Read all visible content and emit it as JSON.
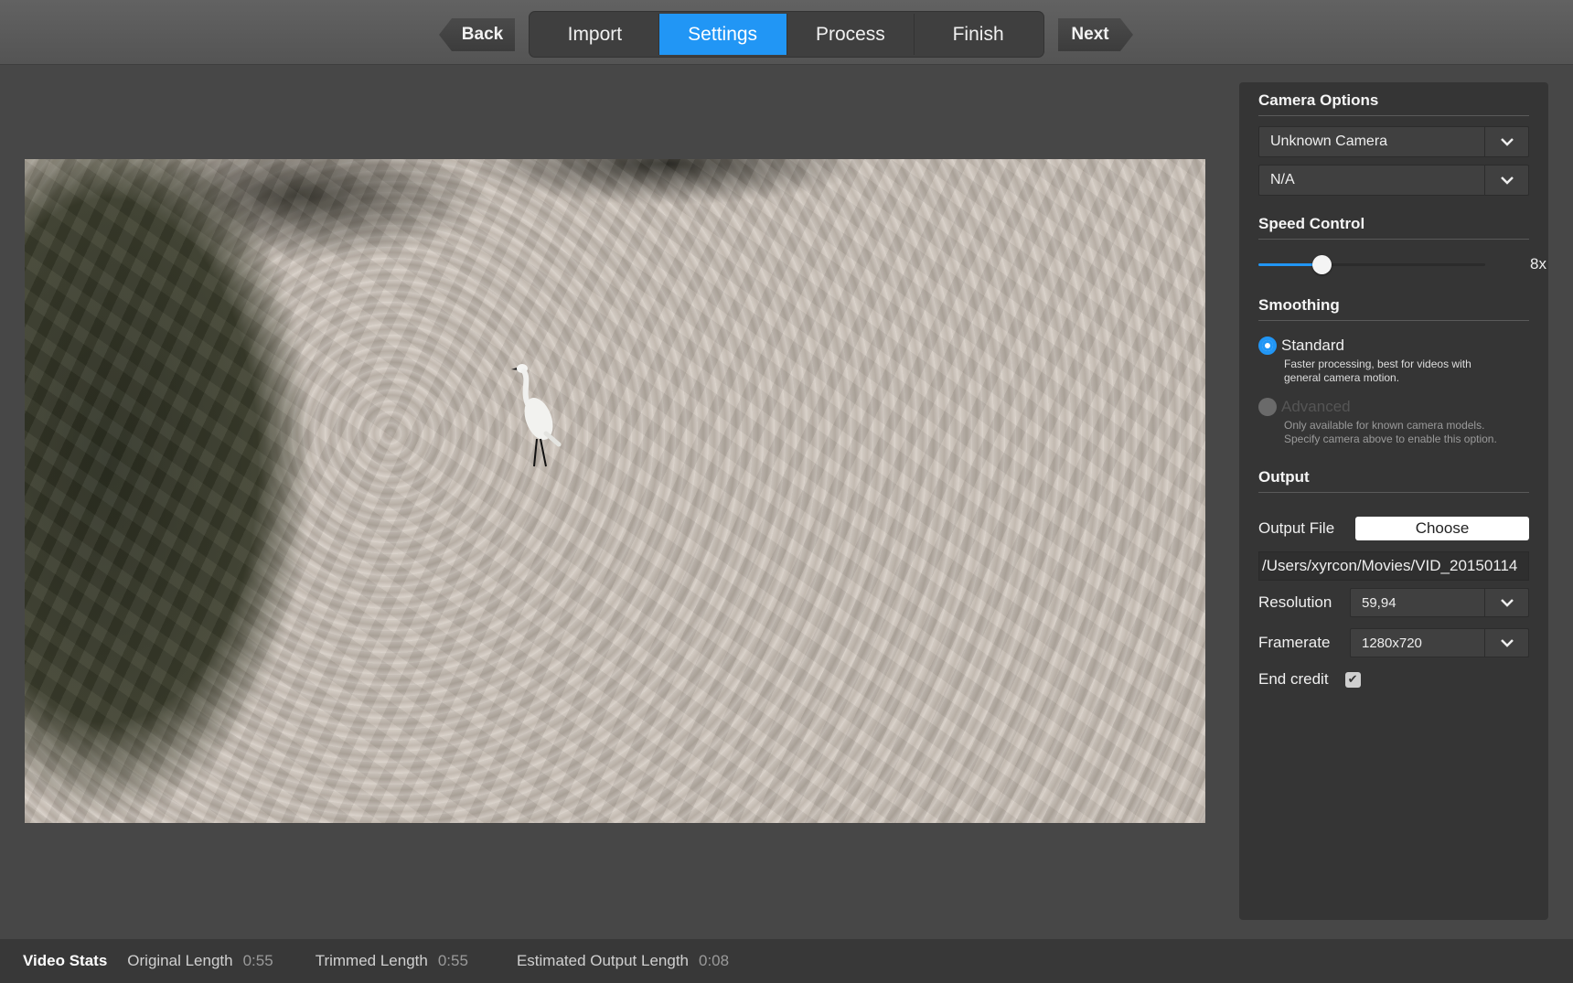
{
  "nav": {
    "back_label": "Back",
    "next_label": "Next",
    "tabs": [
      {
        "label": "Import"
      },
      {
        "label": "Settings"
      },
      {
        "label": "Process"
      },
      {
        "label": "Finish"
      }
    ],
    "active_tab": "Settings"
  },
  "camera_options": {
    "title": "Camera Options",
    "camera_select": "Unknown Camera",
    "model_select": "N/A"
  },
  "speed_control": {
    "title": "Speed Control",
    "value_label": "8x",
    "slider_fraction": 0.28
  },
  "smoothing": {
    "title": "Smoothing",
    "standard_label": "Standard",
    "standard_desc_line1": "Faster processing, best for videos with",
    "standard_desc_line2": "general camera motion.",
    "advanced_label": "Advanced",
    "advanced_desc_line1": "Only available for known camera models.",
    "advanced_desc_line2": "Specify camera above to enable this option.",
    "selected": "Standard"
  },
  "output": {
    "title": "Output",
    "output_file_label": "Output File",
    "choose_label": "Choose",
    "path_value": "/Users/xyrcon/Movies/VID_20150114",
    "resolution_label": "Resolution",
    "resolution_value": "59,94",
    "framerate_label": "Framerate",
    "framerate_value": "1280x720",
    "end_credit_label": "End credit",
    "end_credit_checked": true
  },
  "stats": {
    "title": "Video Stats",
    "original_label": "Original Length",
    "original_value": "0:55",
    "trimmed_label": "Trimmed Length",
    "trimmed_value": "0:55",
    "estimated_label": "Estimated Output Length",
    "estimated_value": "0:08"
  },
  "colors": {
    "accent": "#2196f5",
    "background": "#474747",
    "panel": "#353535"
  }
}
